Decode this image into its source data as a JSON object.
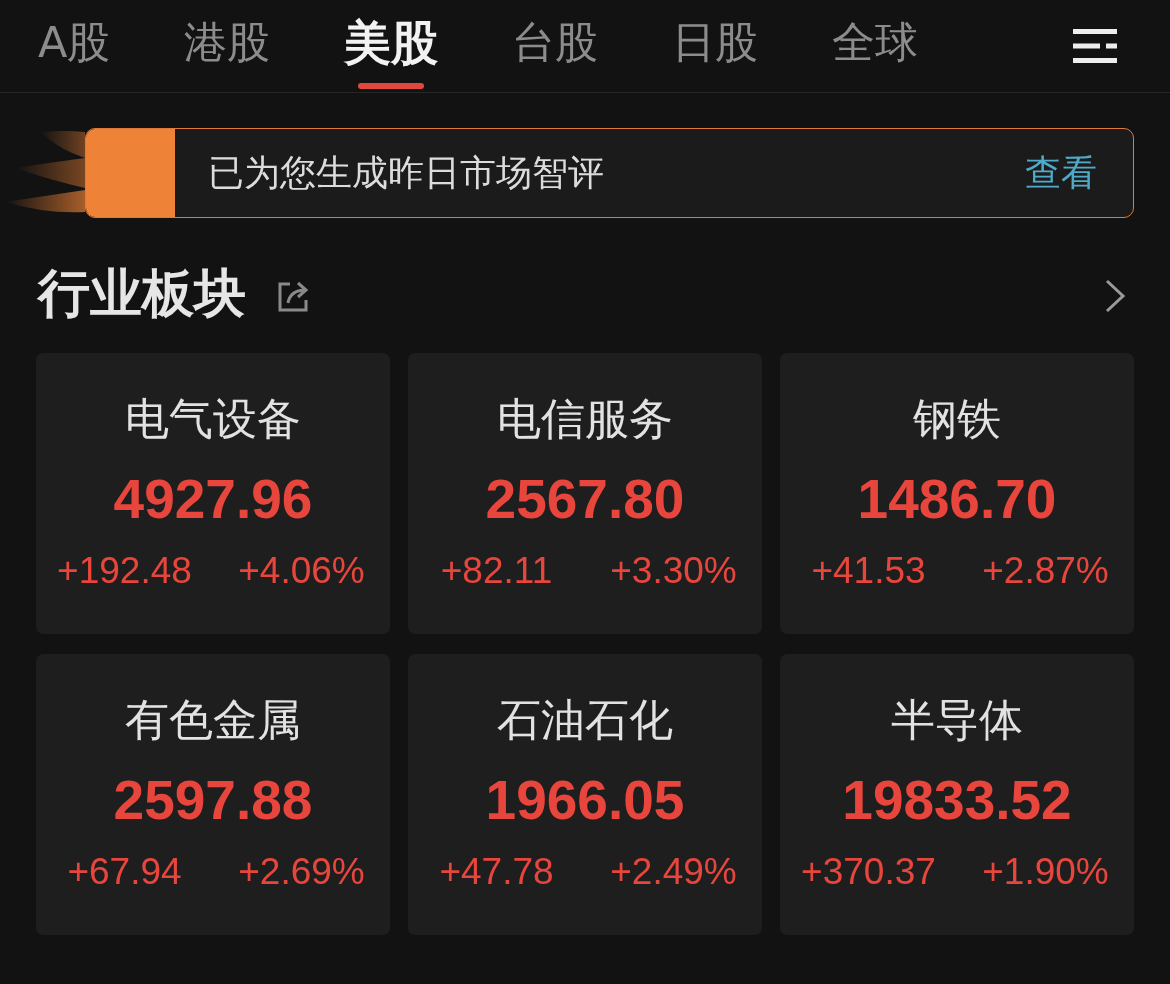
{
  "tabs": [
    {
      "label": "A股",
      "selected": false
    },
    {
      "label": "港股",
      "selected": false
    },
    {
      "label": "美股",
      "selected": true
    },
    {
      "label": "台股",
      "selected": false
    },
    {
      "label": "日股",
      "selected": false
    },
    {
      "label": "全球",
      "selected": false
    }
  ],
  "banner": {
    "text": "已为您生成昨日市场智评",
    "action": "查看"
  },
  "section": {
    "title": "行业板块"
  },
  "sectors": [
    {
      "name": "电气设备",
      "value": "4927.96",
      "change": "+192.48",
      "change_pct": "+4.06%"
    },
    {
      "name": "电信服务",
      "value": "2567.80",
      "change": "+82.11",
      "change_pct": "+3.30%"
    },
    {
      "name": "钢铁",
      "value": "1486.70",
      "change": "+41.53",
      "change_pct": "+2.87%"
    },
    {
      "name": "有色金属",
      "value": "2597.88",
      "change": "+67.94",
      "change_pct": "+2.69%"
    },
    {
      "name": "石油石化",
      "value": "1966.05",
      "change": "+47.78",
      "change_pct": "+2.49%"
    },
    {
      "name": "半导体",
      "value": "19833.52",
      "change": "+370.37",
      "change_pct": "+1.90%"
    }
  ]
}
